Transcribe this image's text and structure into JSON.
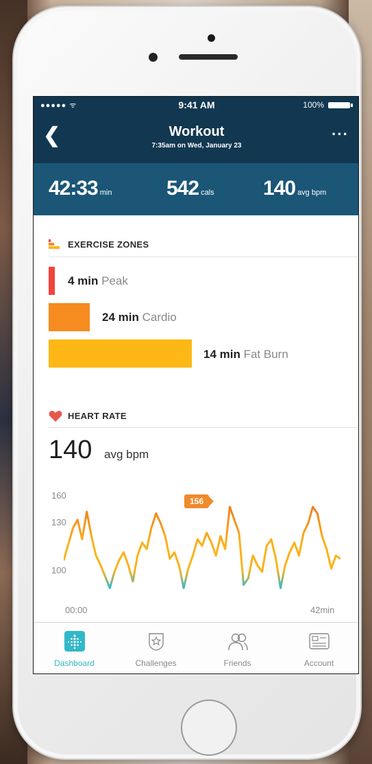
{
  "status_bar": {
    "signal": "●●●●● ᯤ",
    "time": "9:41 AM",
    "battery": "100%"
  },
  "header": {
    "back_icon": "chevron-left-icon",
    "title": "Workout",
    "subtitle": "7:35am on Wed, January 23",
    "more_icon": "more-dots-icon"
  },
  "summary": [
    {
      "value": "42:33",
      "unit": "min"
    },
    {
      "value": "542",
      "unit": "cals"
    },
    {
      "value": "140",
      "unit": "avg bpm"
    }
  ],
  "exercise_zones": {
    "heading": "EXERCISE ZONES",
    "zones": [
      {
        "minutes": "4 min",
        "name": "Peak",
        "color": "#f0453a"
      },
      {
        "minutes": "24 min",
        "name": "Cardio",
        "color": "#f68b1f"
      },
      {
        "minutes": "14 min",
        "name": "Fat Burn",
        "color": "#fdb816"
      }
    ]
  },
  "heart_rate": {
    "heading": "HEART RATE",
    "avg_value": "140",
    "avg_unit": "avg bpm",
    "peak_label": "156"
  },
  "chart_data": {
    "type": "line",
    "x_labels": [
      "00:00",
      "42min"
    ],
    "y_ticks": [
      "160",
      "130",
      "100"
    ],
    "xlim": [
      0,
      42
    ],
    "ylim": [
      88,
      162
    ],
    "peak": {
      "x": 19,
      "y": 156
    },
    "series": [
      {
        "x": [
          0,
          0.7,
          1.4,
          2.1,
          2.8,
          3.5,
          4.2,
          4.9,
          5.6,
          6.3,
          7,
          7.7,
          8.4,
          9.1,
          9.8,
          10.5,
          11.2,
          11.9,
          12.6,
          13.3,
          14,
          14.7,
          15.4,
          16.1,
          16.8,
          17.5,
          18.2,
          18.9,
          19.6,
          20.3,
          21,
          21.7,
          22.4,
          23.1,
          23.8,
          24.5,
          25.2,
          25.9,
          26.6,
          27.3,
          28,
          28.7,
          29.4,
          30.1,
          30.8,
          31.5,
          32.2,
          32.9,
          33.6,
          34.3,
          35,
          35.7,
          36.4,
          37.1,
          37.8,
          38.5,
          39.2,
          39.9,
          40.6,
          41.3,
          42
        ],
        "y": [
          115,
          125,
          135,
          140,
          128,
          145,
          130,
          118,
          112,
          105,
          98,
          108,
          115,
          120,
          112,
          102,
          118,
          126,
          122,
          135,
          144,
          138,
          130,
          116,
          120,
          112,
          98,
          110,
          118,
          128,
          124,
          132,
          126,
          118,
          130,
          122,
          148,
          140,
          132,
          100,
          104,
          118,
          112,
          108,
          124,
          128,
          116,
          98,
          112,
          120,
          126,
          118,
          132,
          138,
          148,
          144,
          130,
          122,
          110,
          118,
          116
        ],
        "color": "#fbb21a"
      }
    ]
  },
  "tabs": [
    {
      "label": "Dashboard",
      "icon": "dashboard-icon",
      "active": true
    },
    {
      "label": "Challenges",
      "icon": "challenges-star-icon",
      "active": false
    },
    {
      "label": "Friends",
      "icon": "friends-icon",
      "active": false
    },
    {
      "label": "Account",
      "icon": "account-card-icon",
      "active": false
    }
  ]
}
